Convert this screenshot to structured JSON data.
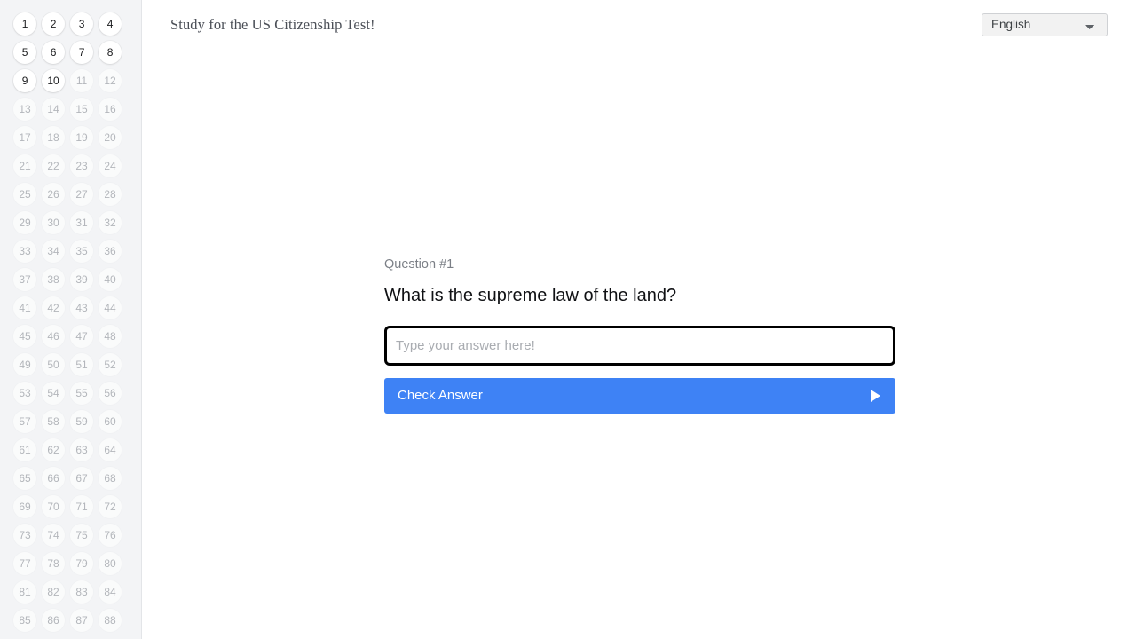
{
  "header": {
    "title": "Study for the US Citizenship Test!",
    "language_select": {
      "name": "language-select",
      "value": "English",
      "options": [
        "English"
      ],
      "icon": "chevron-down-icon"
    }
  },
  "sidebar": {
    "name": "question-navigator",
    "total_questions": 88,
    "unlocked_through": 10,
    "items": [
      {
        "label": "1",
        "state": "active"
      },
      {
        "label": "2",
        "state": "active"
      },
      {
        "label": "3",
        "state": "active"
      },
      {
        "label": "4",
        "state": "active"
      },
      {
        "label": "5",
        "state": "active"
      },
      {
        "label": "6",
        "state": "active"
      },
      {
        "label": "7",
        "state": "active"
      },
      {
        "label": "8",
        "state": "active"
      },
      {
        "label": "9",
        "state": "active"
      },
      {
        "label": "10",
        "state": "active"
      },
      {
        "label": "11",
        "state": "muted"
      },
      {
        "label": "12",
        "state": "muted"
      },
      {
        "label": "13",
        "state": "muted"
      },
      {
        "label": "14",
        "state": "muted"
      },
      {
        "label": "15",
        "state": "muted"
      },
      {
        "label": "16",
        "state": "muted"
      },
      {
        "label": "17",
        "state": "muted"
      },
      {
        "label": "18",
        "state": "muted"
      },
      {
        "label": "19",
        "state": "muted"
      },
      {
        "label": "20",
        "state": "muted"
      },
      {
        "label": "21",
        "state": "muted"
      },
      {
        "label": "22",
        "state": "muted"
      },
      {
        "label": "23",
        "state": "muted"
      },
      {
        "label": "24",
        "state": "muted"
      },
      {
        "label": "25",
        "state": "muted"
      },
      {
        "label": "26",
        "state": "muted"
      },
      {
        "label": "27",
        "state": "muted"
      },
      {
        "label": "28",
        "state": "muted"
      },
      {
        "label": "29",
        "state": "muted"
      },
      {
        "label": "30",
        "state": "muted"
      },
      {
        "label": "31",
        "state": "muted"
      },
      {
        "label": "32",
        "state": "muted"
      },
      {
        "label": "33",
        "state": "muted"
      },
      {
        "label": "34",
        "state": "muted"
      },
      {
        "label": "35",
        "state": "muted"
      },
      {
        "label": "36",
        "state": "muted"
      },
      {
        "label": "37",
        "state": "muted"
      },
      {
        "label": "38",
        "state": "muted"
      },
      {
        "label": "39",
        "state": "muted"
      },
      {
        "label": "40",
        "state": "muted"
      },
      {
        "label": "41",
        "state": "muted"
      },
      {
        "label": "42",
        "state": "muted"
      },
      {
        "label": "43",
        "state": "muted"
      },
      {
        "label": "44",
        "state": "muted"
      },
      {
        "label": "45",
        "state": "muted"
      },
      {
        "label": "46",
        "state": "muted"
      },
      {
        "label": "47",
        "state": "muted"
      },
      {
        "label": "48",
        "state": "muted"
      },
      {
        "label": "49",
        "state": "muted"
      },
      {
        "label": "50",
        "state": "muted"
      },
      {
        "label": "51",
        "state": "muted"
      },
      {
        "label": "52",
        "state": "muted"
      },
      {
        "label": "53",
        "state": "muted"
      },
      {
        "label": "54",
        "state": "muted"
      },
      {
        "label": "55",
        "state": "muted"
      },
      {
        "label": "56",
        "state": "muted"
      },
      {
        "label": "57",
        "state": "muted"
      },
      {
        "label": "58",
        "state": "muted"
      },
      {
        "label": "59",
        "state": "muted"
      },
      {
        "label": "60",
        "state": "muted"
      },
      {
        "label": "61",
        "state": "muted"
      },
      {
        "label": "62",
        "state": "muted"
      },
      {
        "label": "63",
        "state": "muted"
      },
      {
        "label": "64",
        "state": "muted"
      },
      {
        "label": "65",
        "state": "muted"
      },
      {
        "label": "66",
        "state": "muted"
      },
      {
        "label": "67",
        "state": "muted"
      },
      {
        "label": "68",
        "state": "muted"
      },
      {
        "label": "69",
        "state": "muted"
      },
      {
        "label": "70",
        "state": "muted"
      },
      {
        "label": "71",
        "state": "muted"
      },
      {
        "label": "72",
        "state": "muted"
      },
      {
        "label": "73",
        "state": "muted"
      },
      {
        "label": "74",
        "state": "muted"
      },
      {
        "label": "75",
        "state": "muted"
      },
      {
        "label": "76",
        "state": "muted"
      },
      {
        "label": "77",
        "state": "muted"
      },
      {
        "label": "78",
        "state": "muted"
      },
      {
        "label": "79",
        "state": "muted"
      },
      {
        "label": "80",
        "state": "muted"
      },
      {
        "label": "81",
        "state": "muted"
      },
      {
        "label": "82",
        "state": "muted"
      },
      {
        "label": "83",
        "state": "muted"
      },
      {
        "label": "84",
        "state": "muted"
      },
      {
        "label": "85",
        "state": "muted"
      },
      {
        "label": "86",
        "state": "muted"
      },
      {
        "label": "87",
        "state": "muted"
      },
      {
        "label": "88",
        "state": "muted"
      }
    ]
  },
  "quiz": {
    "question_number_label": "Question #1",
    "question_text": "What is the supreme law of the land?",
    "answer_input": {
      "value": "",
      "placeholder": "Type your answer here!",
      "focused": true
    },
    "check_button": {
      "label": "Check Answer",
      "icon": "play-triangle-icon"
    }
  },
  "colors": {
    "accent_blue": "#3e82f5",
    "sidebar_bg": "#f3f4f6",
    "muted_text": "#b3b6bb",
    "question_label": "#7b7f86",
    "page_bg": "#ffffff"
  }
}
